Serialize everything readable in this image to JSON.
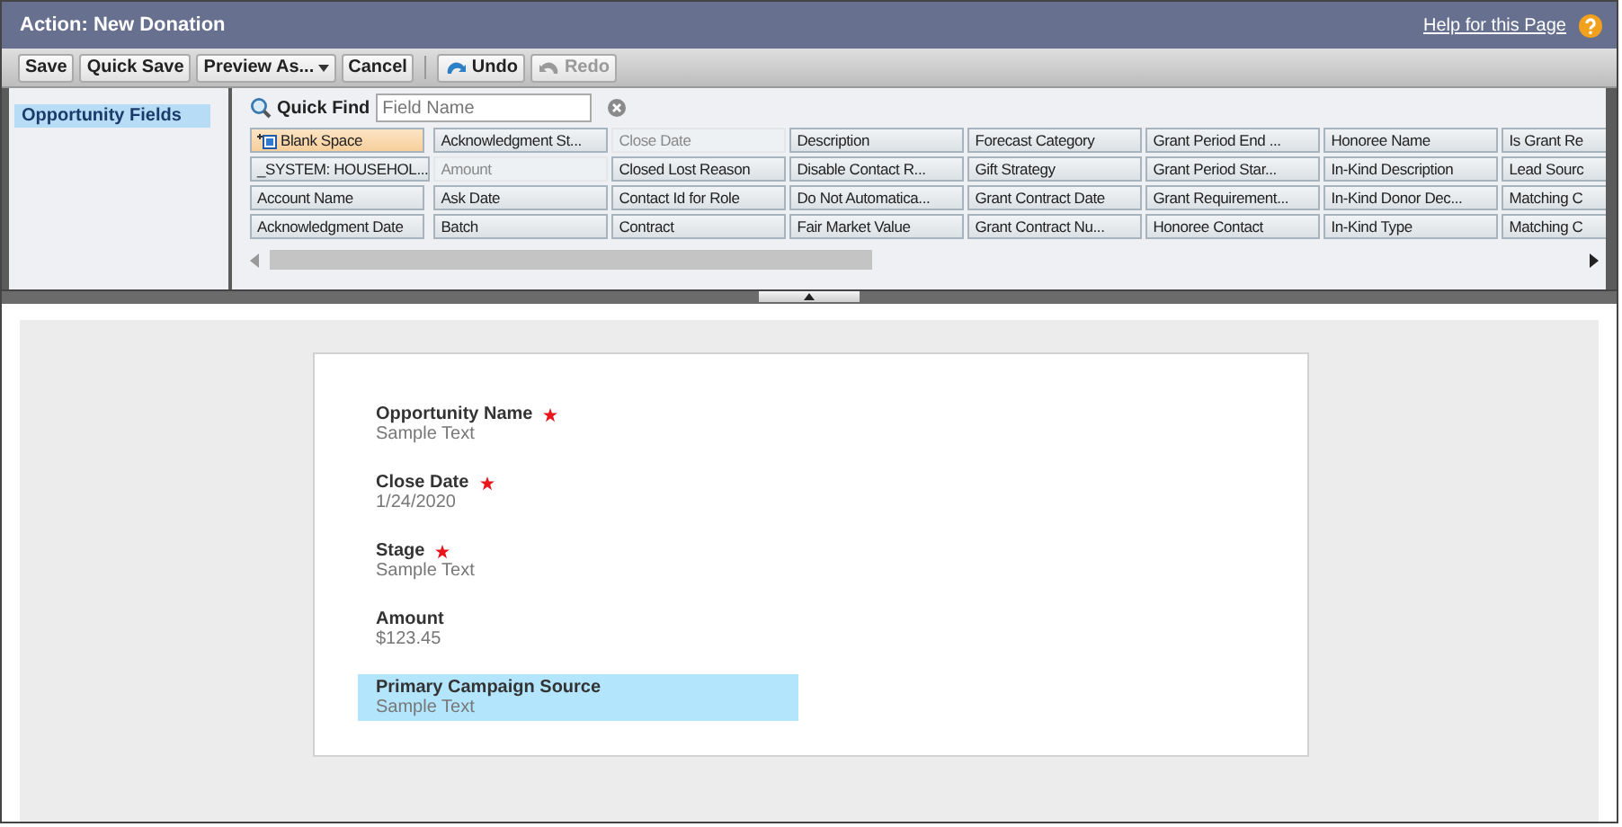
{
  "window": {
    "title": "Action: New Donation",
    "help_link": "Help for this Page"
  },
  "toolbar": [
    {
      "label": "Save",
      "kind": "plain",
      "disabled": false
    },
    {
      "label": "Quick Save",
      "kind": "plain",
      "disabled": false
    },
    {
      "label": "Preview As...",
      "kind": "dropdown",
      "disabled": false
    },
    {
      "label": "Cancel",
      "kind": "plain",
      "disabled": false
    },
    {
      "label": "Undo",
      "kind": "undo",
      "disabled": false
    },
    {
      "label": "Redo",
      "kind": "redo",
      "disabled": true
    }
  ],
  "sidebar": {
    "items": [
      {
        "label": "Opportunity Fields",
        "selected": true
      }
    ]
  },
  "quick_find": {
    "label": "Quick Find",
    "placeholder": "Field Name"
  },
  "palette": {
    "columns": [
      [
        {
          "label": "Blank Space",
          "kind": "blank",
          "used": false
        },
        {
          "label": "_SYSTEM: HOUSEHOL...",
          "kind": "field",
          "used": false
        },
        {
          "label": "Account Name",
          "kind": "field",
          "used": false
        },
        {
          "label": "Acknowledgment Date",
          "kind": "field",
          "used": false
        }
      ],
      [
        {
          "label": "Acknowledgment St...",
          "kind": "field",
          "used": false
        },
        {
          "label": "Amount",
          "kind": "field",
          "used": true
        },
        {
          "label": "Ask Date",
          "kind": "field",
          "used": false
        },
        {
          "label": "Batch",
          "kind": "field",
          "used": false
        }
      ],
      [
        {
          "label": "Close Date",
          "kind": "field",
          "used": true
        },
        {
          "label": "Closed Lost Reason",
          "kind": "field",
          "used": false
        },
        {
          "label": "Contact Id for Role",
          "kind": "field",
          "used": false
        },
        {
          "label": "Contract",
          "kind": "field",
          "used": false
        }
      ],
      [
        {
          "label": "Description",
          "kind": "field",
          "used": false
        },
        {
          "label": "Disable Contact R...",
          "kind": "field",
          "used": false
        },
        {
          "label": "Do Not Automatica...",
          "kind": "field",
          "used": false
        },
        {
          "label": "Fair Market Value",
          "kind": "field",
          "used": false
        }
      ],
      [
        {
          "label": "Forecast Category",
          "kind": "field",
          "used": false
        },
        {
          "label": "Gift Strategy",
          "kind": "field",
          "used": false
        },
        {
          "label": "Grant Contract Date",
          "kind": "field",
          "used": false
        },
        {
          "label": "Grant Contract Nu...",
          "kind": "field",
          "used": false
        }
      ],
      [
        {
          "label": "Grant Period End ...",
          "kind": "field",
          "used": false
        },
        {
          "label": "Grant Period Star...",
          "kind": "field",
          "used": false
        },
        {
          "label": "Grant Requirement...",
          "kind": "field",
          "used": false
        },
        {
          "label": "Honoree Contact",
          "kind": "field",
          "used": false
        }
      ],
      [
        {
          "label": "Honoree Name",
          "kind": "field",
          "used": false
        },
        {
          "label": "In-Kind Description",
          "kind": "field",
          "used": false
        },
        {
          "label": "In-Kind Donor Dec...",
          "kind": "field",
          "used": false
        },
        {
          "label": "In-Kind Type",
          "kind": "field",
          "used": false
        }
      ],
      [
        {
          "label": "Is Grant Re",
          "kind": "field",
          "used": false
        },
        {
          "label": "Lead Sourc",
          "kind": "field",
          "used": false
        },
        {
          "label": "Matching C",
          "kind": "field",
          "used": false
        },
        {
          "label": "Matching C",
          "kind": "field",
          "used": false
        }
      ]
    ]
  },
  "layout": {
    "fields": [
      {
        "label": "Opportunity Name",
        "value": "Sample Text",
        "required": true,
        "selected": false
      },
      {
        "label": "Close Date",
        "value": "1/24/2020",
        "required": true,
        "selected": false
      },
      {
        "label": "Stage",
        "value": "Sample Text",
        "required": true,
        "selected": false
      },
      {
        "label": "Amount",
        "value": "$123.45",
        "required": false,
        "selected": false
      },
      {
        "label": "Primary Campaign Source",
        "value": "Sample Text",
        "required": false,
        "selected": true
      }
    ]
  }
}
